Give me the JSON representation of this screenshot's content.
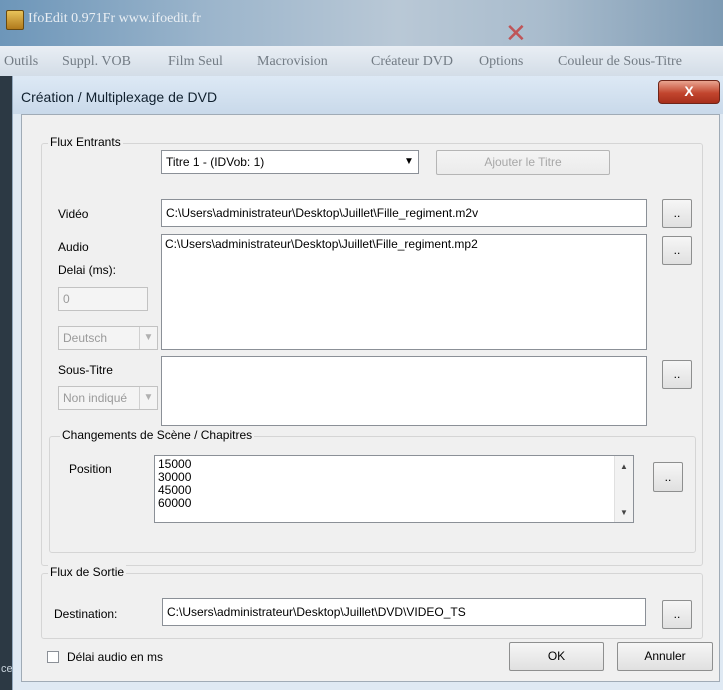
{
  "app": {
    "title": "IfoEdit 0.971Fr  www.ifoedit.fr",
    "menu": [
      "Outils",
      "Suppl. VOB",
      "Film Seul",
      "Macrovision",
      "Créateur DVD",
      "Options",
      "Couleur de Sous-Titre"
    ],
    "left_strip_text": "ce"
  },
  "dialog": {
    "title": "Création / Multiplexage de DVD",
    "close_glyph": "X",
    "flux_entrants": {
      "label": "Flux Entrants",
      "titre_select": "Titre 1 - (IDVob: 1)",
      "add_title_button": "Ajouter le Titre",
      "video_label": "Vidéo",
      "video_path": "C:\\Users\\administrateur\\Desktop\\Juillet\\Fille_regiment.m2v",
      "audio_label": "Audio",
      "audio_path": "C:\\Users\\administrateur\\Desktop\\Juillet\\Fille_regiment.mp2",
      "delai_label": "Delai (ms):",
      "delai_value": "0",
      "audio_language": "Deutsch",
      "subtitle_label": "Sous-Titre",
      "subtitle_language": "Non indiqué",
      "browse_label": "..",
      "chapters": {
        "label": "Changements de Scène / Chapitres",
        "position_label": "Position",
        "positions": [
          "15000",
          "30000",
          "45000",
          "60000"
        ]
      }
    },
    "flux_sortie": {
      "label": "Flux de Sortie",
      "destination_label": "Destination:",
      "destination_path": "C:\\Users\\administrateur\\Desktop\\Juillet\\DVD\\VIDEO_TS"
    },
    "audio_delay_checkbox": "Délai audio en ms",
    "ok_button": "OK",
    "cancel_button": "Annuler"
  }
}
